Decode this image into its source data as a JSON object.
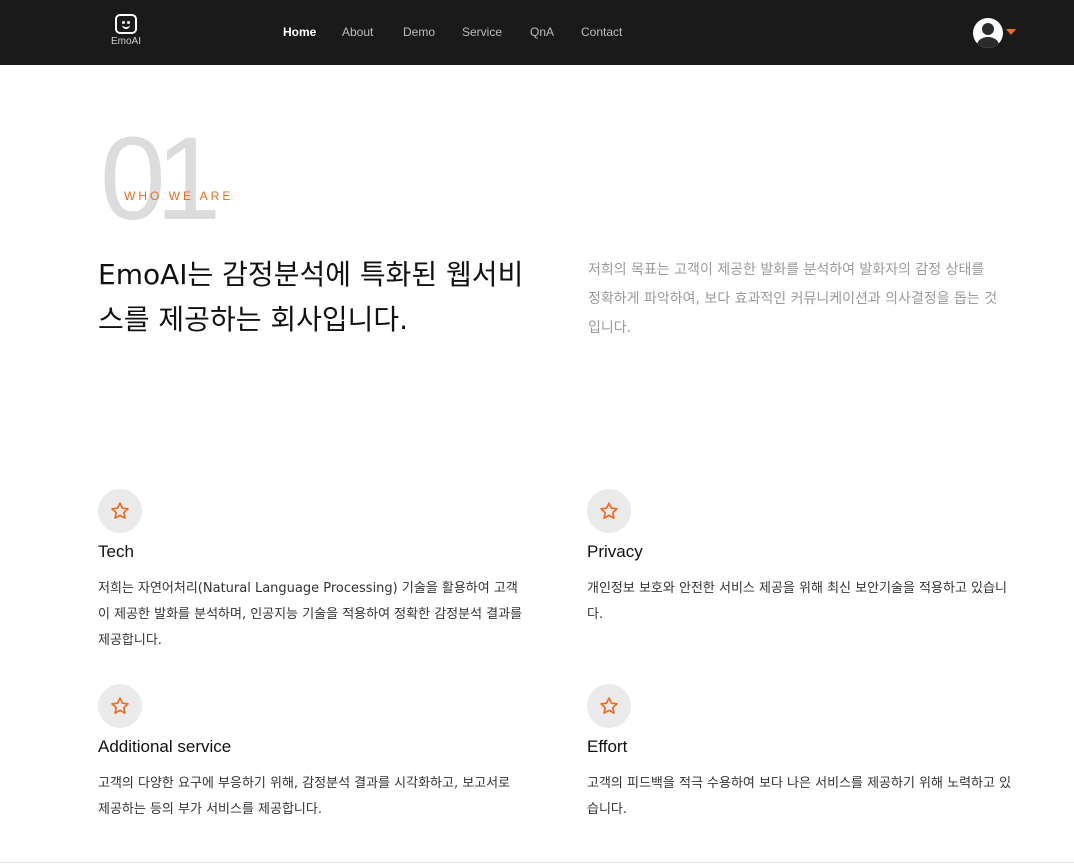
{
  "brand": {
    "logo_text": "EmoAI"
  },
  "nav": {
    "items": [
      {
        "label": "Home",
        "active": true
      },
      {
        "label": "About"
      },
      {
        "label": "Demo"
      },
      {
        "label": "Service"
      },
      {
        "label": "QnA"
      },
      {
        "label": "Contact"
      }
    ]
  },
  "user_menu": {
    "icon": "user-avatar-icon",
    "caret_icon": "caret-down-icon",
    "accent": "#f26b1d"
  },
  "about": {
    "number": "01",
    "label": "WHO WE ARE",
    "headline": "EmoAI는 감정분석에 특화된 웹서비스를 제공하는 회사입니다.",
    "intro": "저희의 목표는 고객이 제공한 발화를 분석하여 발화자의 감정 상태를 정확하게 파악하여, 보다 효과적인 커뮤니케이션과 의사결정을 돕는 것입니다."
  },
  "features": [
    {
      "icon": "star-icon",
      "title": "Tech",
      "desc": "저희는 자연어처리(Natural Language Processing) 기술을 활용하여 고객이 제공한 발화를 분석하며, 인공지능 기술을 적용하여 정확한 감정분석 결과를 제공합니다."
    },
    {
      "icon": "star-icon",
      "title": "Privacy",
      "desc": "개인정보 보호와 안전한 서비스 제공을 위해 최신 보안기술을 적용하고 있습니다."
    },
    {
      "icon": "star-icon",
      "title": "Additional service",
      "desc": "고객의 다양한 요구에 부응하기 위해, 감정분석 결과를 시각화하고, 보고서로 제공하는 등의 부가 서비스를 제공합니다."
    },
    {
      "icon": "star-icon",
      "title": "Effort",
      "desc": "고객의 피드백을 적극 수용하여 보다 나은 서비스를 제공하기 위해 노력하고 있습니다."
    }
  ],
  "colors": {
    "header_bg": "#1a1a1a",
    "accent": "#f26b1d",
    "muted_text": "#9a9a9a"
  }
}
